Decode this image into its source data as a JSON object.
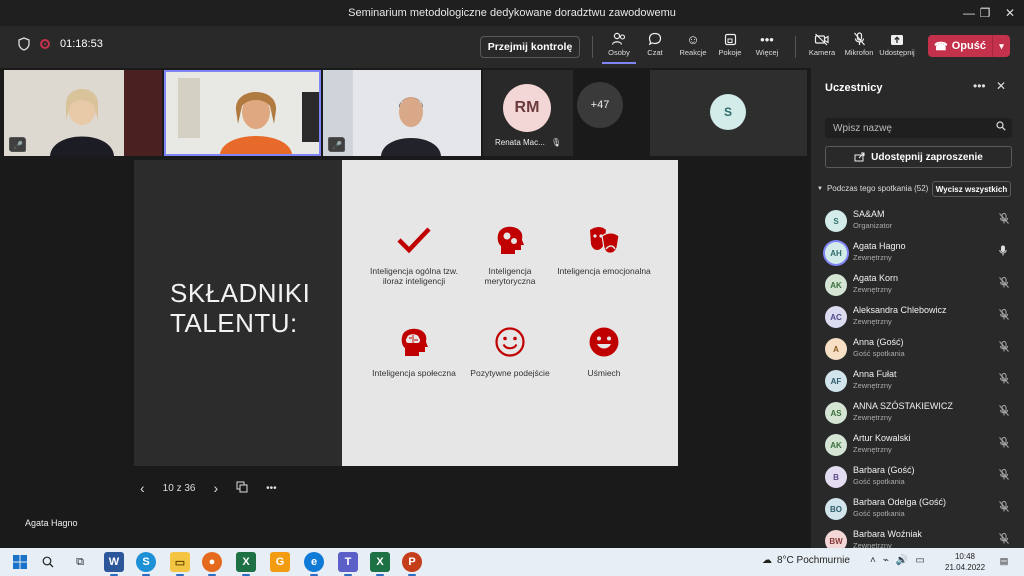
{
  "window": {
    "title": "Seminarium metodologiczne dedykowane doradztwu zawodowemu"
  },
  "meeting": {
    "elapsed": "01:18:53",
    "take_control_label": "Przejmij kontrolę",
    "leave_label": "Opuść"
  },
  "toolbar": {
    "buttons": [
      {
        "label": "Osoby",
        "icon": "people-icon"
      },
      {
        "label": "Czat",
        "icon": "chat-icon"
      },
      {
        "label": "Reakcje",
        "icon": "reactions-icon"
      },
      {
        "label": "Pokoje",
        "icon": "rooms-icon"
      },
      {
        "label": "Więcej",
        "icon": "more-icon"
      },
      {
        "label": "Kamera",
        "icon": "camera-off-icon"
      },
      {
        "label": "Mikrofon",
        "icon": "mic-off-icon"
      },
      {
        "label": "Udostępnij",
        "icon": "share-icon"
      }
    ]
  },
  "video": {
    "tile4": {
      "initials": "RM",
      "name": "Renata Mac..."
    },
    "tile5": {
      "overflow": "+47"
    },
    "tile6": {
      "initials": "S"
    },
    "speaker_name": "Agata Hagno"
  },
  "slide": {
    "title": "SKŁADNIKI\nTALENTU:",
    "features": [
      {
        "label": "Inteligencja ogólna tzw. iloraz inteligencji",
        "icon": "checkmark-icon"
      },
      {
        "label": "Inteligencja merytoryczna",
        "icon": "head-gears-icon"
      },
      {
        "label": "Inteligencja emocjonalna",
        "icon": "theater-masks-icon"
      },
      {
        "label": "Inteligencja społeczna",
        "icon": "head-brain-icon"
      },
      {
        "label": "Pozytywne podejście",
        "icon": "smile-outline-icon"
      },
      {
        "label": "Uśmiech",
        "icon": "smile-filled-icon"
      }
    ],
    "page": "10 z 36",
    "accent": "#c00000"
  },
  "participants": {
    "title": "Uczestnicy",
    "search_placeholder": "Wpisz nazwę",
    "share_invite": "Udostępnij zaproszenie",
    "section_label": "Podczas tego spotkania (52)",
    "mute_all": "Wycisz wszystkich",
    "list": [
      {
        "initials": "S",
        "name": "SA&AM",
        "role": "Organizator",
        "bg": "#d3ecea",
        "fg": "#2e6b68",
        "mic": "muted"
      },
      {
        "initials": "AH",
        "name": "Agata Hagno",
        "role": "Zewnętrzny",
        "bg": "#d3ecea",
        "fg": "#2e6b68",
        "mic": "on"
      },
      {
        "initials": "AK",
        "name": "Agata Korn",
        "role": "Zewnętrzny",
        "bg": "#d4e5d4",
        "fg": "#3c6e3c",
        "mic": "muted"
      },
      {
        "initials": "AC",
        "name": "Aleksandra Chlebowicz",
        "role": "Zewnętrzny",
        "bg": "#dcdcf0",
        "fg": "#4b4b8a",
        "mic": "muted"
      },
      {
        "initials": "A",
        "name": "Anna (Gość)",
        "role": "Gość spotkania",
        "bg": "#f6dfc4",
        "fg": "#8a5a20",
        "mic": "muted"
      },
      {
        "initials": "AF",
        "name": "Anna Fułat",
        "role": "Zewnętrzny",
        "bg": "#d3e5ec",
        "fg": "#2e5d6b",
        "mic": "muted"
      },
      {
        "initials": "AS",
        "name": "ANNA SZÓSTAKIEWICZ",
        "role": "Zewnętrzny",
        "bg": "#d4e5d4",
        "fg": "#3c6e3c",
        "mic": "muted"
      },
      {
        "initials": "AK",
        "name": "Artur Kowalski",
        "role": "Zewnętrzny",
        "bg": "#d4e5d4",
        "fg": "#3c6e3c",
        "mic": "muted"
      },
      {
        "initials": "B",
        "name": "Barbara (Gość)",
        "role": "Gość spotkania",
        "bg": "#e4dcf0",
        "fg": "#5a4b8a",
        "mic": "muted"
      },
      {
        "initials": "BO",
        "name": "Barbara Odelga (Gość)",
        "role": "Gość spotkania",
        "bg": "#d3e5ec",
        "fg": "#2e5d6b",
        "mic": "muted"
      },
      {
        "initials": "BW",
        "name": "Barbara Woźniak",
        "role": "Zewnętrzny",
        "bg": "#f3d6d6",
        "fg": "#8a3a3a",
        "mic": "muted"
      }
    ]
  },
  "taskbar": {
    "weather": "8°C  Pochmurnie",
    "time": "10:48",
    "date": "21.04.2022"
  }
}
